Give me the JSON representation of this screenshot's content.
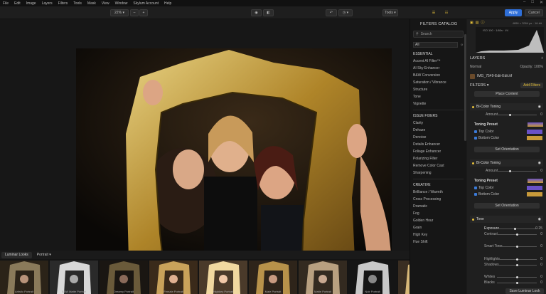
{
  "menu": [
    "File",
    "Edit",
    "Image",
    "Layers",
    "Filters",
    "Tools",
    "Mask",
    "View",
    "Window",
    "Skylum Account",
    "Help"
  ],
  "toolbar": {
    "zoom": "22%",
    "minus": "–",
    "plus": "+",
    "tools": "Tools",
    "apply": "Apply",
    "cancel": "Cancel"
  },
  "filmstrip": {
    "tabs": [
      "Luminar Looks",
      "Portrait"
    ],
    "looks": [
      "Artistic Portrait",
      "B&W Matte Portrait",
      "Dreamy Portrait",
      "Female Portrait",
      "Highkey Portrait",
      "Male Portrait",
      "Matte Portrait",
      "Noir Portrait",
      "Smooth Portrait"
    ]
  },
  "catalog": {
    "title": "FILTERS CATALOG",
    "search_placeholder": "Search",
    "filter_all": "All",
    "groups": [
      {
        "name": "ESSENTIAL",
        "items": [
          "Accent AI Filter™",
          "AI Sky Enhancer",
          "B&W Conversion",
          "Saturation / Vibrance",
          "Structure",
          "Tone",
          "Vignette"
        ]
      },
      {
        "name": "ISSUE FIXERS",
        "items": [
          "Clarity",
          "Dehaze",
          "Denoise",
          "Details Enhancer",
          "Foliage Enhancer",
          "Polarizing Filter",
          "Remove Color Cast",
          "Sharpening"
        ]
      },
      {
        "name": "CREATIVE",
        "items": [
          "Brilliance / Warmth",
          "Cross Processing",
          "Dramatic",
          "Fog",
          "Golden Hour",
          "Grain",
          "High Key",
          "Hue Shift"
        ]
      }
    ]
  },
  "panel": {
    "histo_text": "ISO 100 · 1/60s · f/4",
    "histo_header": "4896 × 3264 px · 16-bit",
    "layers_title": "LAYERS",
    "blend": "Normal",
    "opacity": "Opacity: 100%",
    "layer_name": "IMG_7549-Edit-Edit.tif",
    "filters_title": "FILTERS",
    "add_filters": "Add Filters",
    "place_content": "Place Content",
    "bicolor_title": "Bi-Color Toning",
    "amount_label": "Amount",
    "amount_value": "0",
    "toning_preset": "Toning Preset",
    "top_color": "Top Color",
    "bottom_color": "Bottom Color",
    "set_orientation": "Set Orientation",
    "tone_title": "Tone",
    "exposure_label": "Exposure",
    "exposure_value": "0.25",
    "contrast_label": "Contrast",
    "contrast_value": "0",
    "smart_tone_label": "Smart Tone",
    "smart_tone_value": "0",
    "highlights_label": "Highlights",
    "highlights_value": "0",
    "shadows_label": "Shadows",
    "shadows_value": "0",
    "whites_label": "Whites",
    "whites_value": "0",
    "blacks_label": "Blacks",
    "blacks_value": "0",
    "save_look": "Save Luminar Look"
  },
  "colors": {
    "accent": "#2f6fd8",
    "gold": "#e8c23a",
    "top_color": "#6a52c8",
    "bottom_color": "#c89a3a"
  }
}
